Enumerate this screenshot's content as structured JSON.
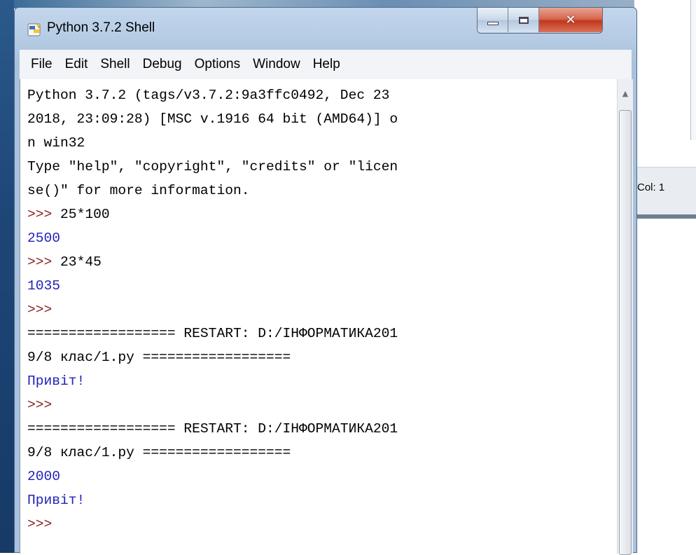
{
  "window": {
    "title": "Python 3.7.2 Shell"
  },
  "background_window": {
    "status_label": "Col: 1"
  },
  "menu": [
    "File",
    "Edit",
    "Shell",
    "Debug",
    "Options",
    "Window",
    "Help"
  ],
  "shell_lines": [
    {
      "text": "Python 3.7.2 (tags/v3.7.2:9a3ffc0492, Dec 23",
      "kind": "normal"
    },
    {
      "text": "2018, 23:09:28) [MSC v.1916 64 bit (AMD64)] o",
      "kind": "normal"
    },
    {
      "text": "n win32",
      "kind": "normal"
    },
    {
      "text": "Type \"help\", \"copyright\", \"credits\" or \"licen",
      "kind": "normal"
    },
    {
      "text": "se()\" for more information.",
      "kind": "normal"
    },
    {
      "text": ">>> 25*100",
      "kind": "input"
    },
    {
      "text": "2500",
      "kind": "out"
    },
    {
      "text": ">>> 23*45",
      "kind": "input"
    },
    {
      "text": "1035",
      "kind": "out"
    },
    {
      "text": ">>>",
      "kind": "prompt"
    },
    {
      "text": "================== RESTART: D:/ІНФОРМАТИКА201",
      "kind": "normal"
    },
    {
      "text": "9/8 клас/1.py ==================",
      "kind": "normal"
    },
    {
      "text": "Привіт!",
      "kind": "out"
    },
    {
      "text": ">>>",
      "kind": "prompt"
    },
    {
      "text": "================== RESTART: D:/ІНФОРМАТИКА201",
      "kind": "normal"
    },
    {
      "text": "9/8 клас/1.py ==================",
      "kind": "normal"
    },
    {
      "text": "2000",
      "kind": "out"
    },
    {
      "text": "Привіт!",
      "kind": "out"
    },
    {
      "text": ">>>",
      "kind": "prompt"
    }
  ],
  "colors": {
    "output": "#2222bb",
    "prompt": "#882222",
    "close_button": "#c2381c"
  },
  "icons": {
    "app": "python-shell-icon",
    "minimize": "minimize-icon",
    "maximize": "maximize-icon",
    "close": "close-icon",
    "scroll_up": "scroll-up-arrow-icon"
  }
}
